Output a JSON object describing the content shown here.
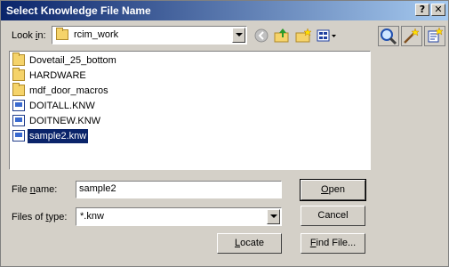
{
  "window": {
    "title": "Select Knowledge File Name",
    "help_glyph": "?",
    "close_glyph": "✕"
  },
  "lookin": {
    "label": "Look in:",
    "value": "rcim_work"
  },
  "toolbar": [
    "back-icon",
    "up-folder-icon",
    "new-folder-icon",
    "view-menu-icon"
  ],
  "side_icons": [
    "magnifier-icon",
    "wizard-icon",
    "settings-icon"
  ],
  "files": [
    {
      "name": "Dovetail_25_bottom",
      "type": "folder"
    },
    {
      "name": "HARDWARE",
      "type": "folder"
    },
    {
      "name": "mdf_door_macros",
      "type": "folder"
    },
    {
      "name": "DOITALL.KNW",
      "type": "knw"
    },
    {
      "name": "DOITNEW.KNW",
      "type": "knw"
    },
    {
      "name": "sample2.knw",
      "type": "knw",
      "selected": true
    }
  ],
  "filename": {
    "label": "File name:",
    "value": "sample2"
  },
  "filetype": {
    "label": "Files of type:",
    "value": "*.knw"
  },
  "buttons": {
    "open": "Open",
    "cancel": "Cancel",
    "locate": "Locate",
    "find": "Find File..."
  }
}
